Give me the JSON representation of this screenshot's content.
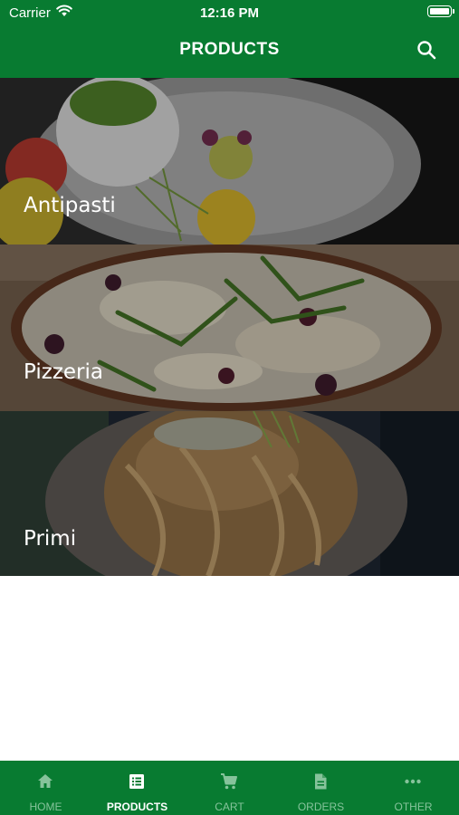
{
  "status_bar": {
    "carrier": "Carrier",
    "time": "12:16 PM"
  },
  "nav": {
    "title": "PRODUCTS",
    "search_icon": "search-icon"
  },
  "categories": [
    {
      "label": "Antipasti"
    },
    {
      "label": "Pizzeria"
    },
    {
      "label": "Primi"
    }
  ],
  "tabbar": {
    "active": "PRODUCTS",
    "items": [
      {
        "label": "HOME",
        "icon": "home-icon"
      },
      {
        "label": "PRODUCTS",
        "icon": "list-icon"
      },
      {
        "label": "CART",
        "icon": "cart-icon"
      },
      {
        "label": "ORDERS",
        "icon": "document-icon"
      },
      {
        "label": "OTHER",
        "icon": "more-icon"
      }
    ]
  },
  "colors": {
    "primary": "#087b31",
    "inactive_tab": "#86c39b",
    "text_on_primary": "#ffffff"
  }
}
